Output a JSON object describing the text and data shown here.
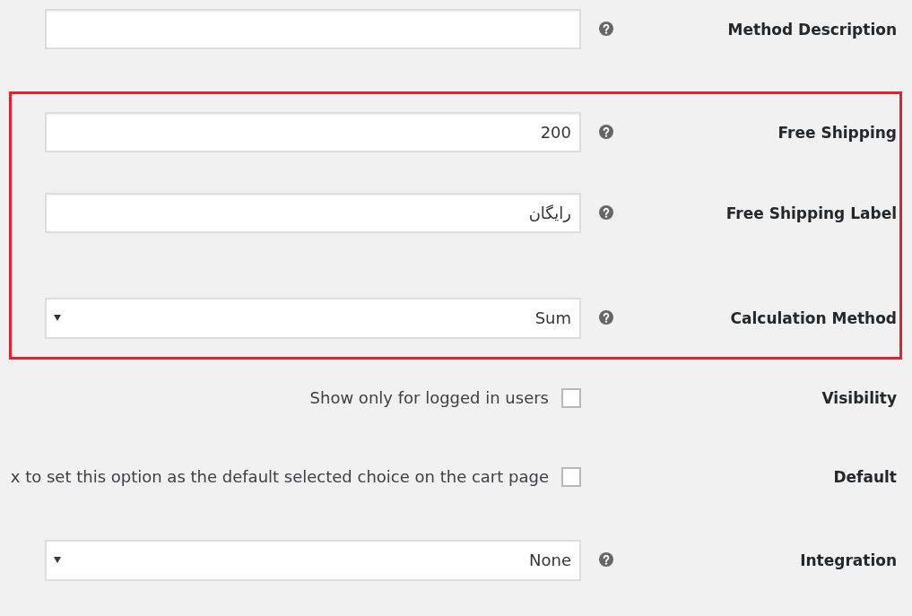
{
  "groups": [
    {
      "highlighted": false,
      "fields": [
        {
          "kind": "text",
          "label": "Method Description",
          "help": true
        }
      ]
    },
    {
      "highlighted": true,
      "fields": [
        {
          "kind": "text",
          "label": "Free Shipping",
          "value": "200",
          "help": true
        },
        {
          "kind": "text",
          "label": "Free Shipping Label",
          "value": "رایگان",
          "help": true
        },
        {
          "kind": "select",
          "label": "Calculation Method",
          "value": "Sum",
          "help": true
        }
      ]
    },
    {
      "highlighted": false,
      "fields": [
        {
          "kind": "checkbox",
          "label": "Visibility",
          "text": "Show only for logged in users",
          "checked": false,
          "help": false
        },
        {
          "kind": "checkbox",
          "label": "Default",
          "text": "x to set this option as the default selected choice on the cart page",
          "checked": false,
          "help": false
        },
        {
          "kind": "select",
          "label": "Integration",
          "value": "None",
          "help": true
        }
      ]
    }
  ]
}
